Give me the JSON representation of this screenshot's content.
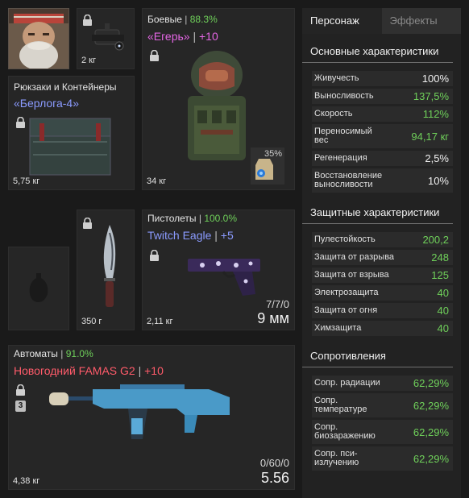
{
  "head_slot": {},
  "nv_slot": {
    "weight": "2 кг"
  },
  "backpack_slot": {
    "category": "Рюкзаки и Контейнеры",
    "name": "«Берлога-4»",
    "weight": "5,75 кг"
  },
  "armor_slot": {
    "category": "Боевые",
    "separator": "|",
    "percent": "88.3%",
    "name": "«Егерь»",
    "upgrade": "+10",
    "weight": "34 кг",
    "container_percent": "35%"
  },
  "knife_slot": {
    "weight": "350 г"
  },
  "pistol_slot": {
    "category": "Пистолеты",
    "separator": "|",
    "percent": "100.0%",
    "name": "Twitch Eagle",
    "upgrade": "+5",
    "weight": "2,11 кг",
    "ammo": "7/7/0",
    "caliber": "9 мм"
  },
  "rifle_slot": {
    "category": "Автоматы",
    "separator": "|",
    "percent": "91.0%",
    "name": "Новогодний FAMAS G2",
    "upgrade": "+10",
    "weight": "4,38 кг",
    "ammo": "0/60/0",
    "caliber": "5.56",
    "badge": "3"
  },
  "tabs": {
    "character": "Персонаж",
    "effects": "Эффекты"
  },
  "sections": {
    "main": {
      "title": "Основные характеристики",
      "rows": [
        {
          "label": "Живучесть",
          "value": "100%",
          "green": false
        },
        {
          "label": "Выносливость",
          "value": "137,5%",
          "green": true
        },
        {
          "label": "Скорость",
          "value": "112%",
          "green": true
        },
        {
          "label": "Переносимый вес",
          "value": "94,17 кг",
          "green": true
        },
        {
          "label": "Регенерация",
          "value": "2,5%",
          "green": false
        },
        {
          "label": "Восстановление выносливости",
          "value": "10%",
          "green": false
        }
      ]
    },
    "defense": {
      "title": "Защитные характеристики",
      "rows": [
        {
          "label": "Пулестойкость",
          "value": "200,2",
          "green": true
        },
        {
          "label": "Защита от разрыва",
          "value": "248",
          "green": true
        },
        {
          "label": "Защита от взрыва",
          "value": "125",
          "green": true
        },
        {
          "label": "Электрозащита",
          "value": "40",
          "green": true
        },
        {
          "label": "Защита от огня",
          "value": "40",
          "green": true
        },
        {
          "label": "Химзащита",
          "value": "40",
          "green": true
        }
      ]
    },
    "resist": {
      "title": "Сопротивления",
      "rows": [
        {
          "label": "Сопр. радиации",
          "value": "62,29%",
          "green": true
        },
        {
          "label": "Сопр. температуре",
          "value": "62,29%",
          "green": true
        },
        {
          "label": "Сопр. биозаражению",
          "value": "62,29%",
          "green": true
        },
        {
          "label": "Сопр. пси-излучению",
          "value": "62,29%",
          "green": true
        }
      ]
    }
  },
  "colors": {
    "percent_green": "#6fd05a",
    "name_blue": "#8b9bff",
    "name_pink": "#e466e4",
    "name_red": "#ff5b6a"
  }
}
